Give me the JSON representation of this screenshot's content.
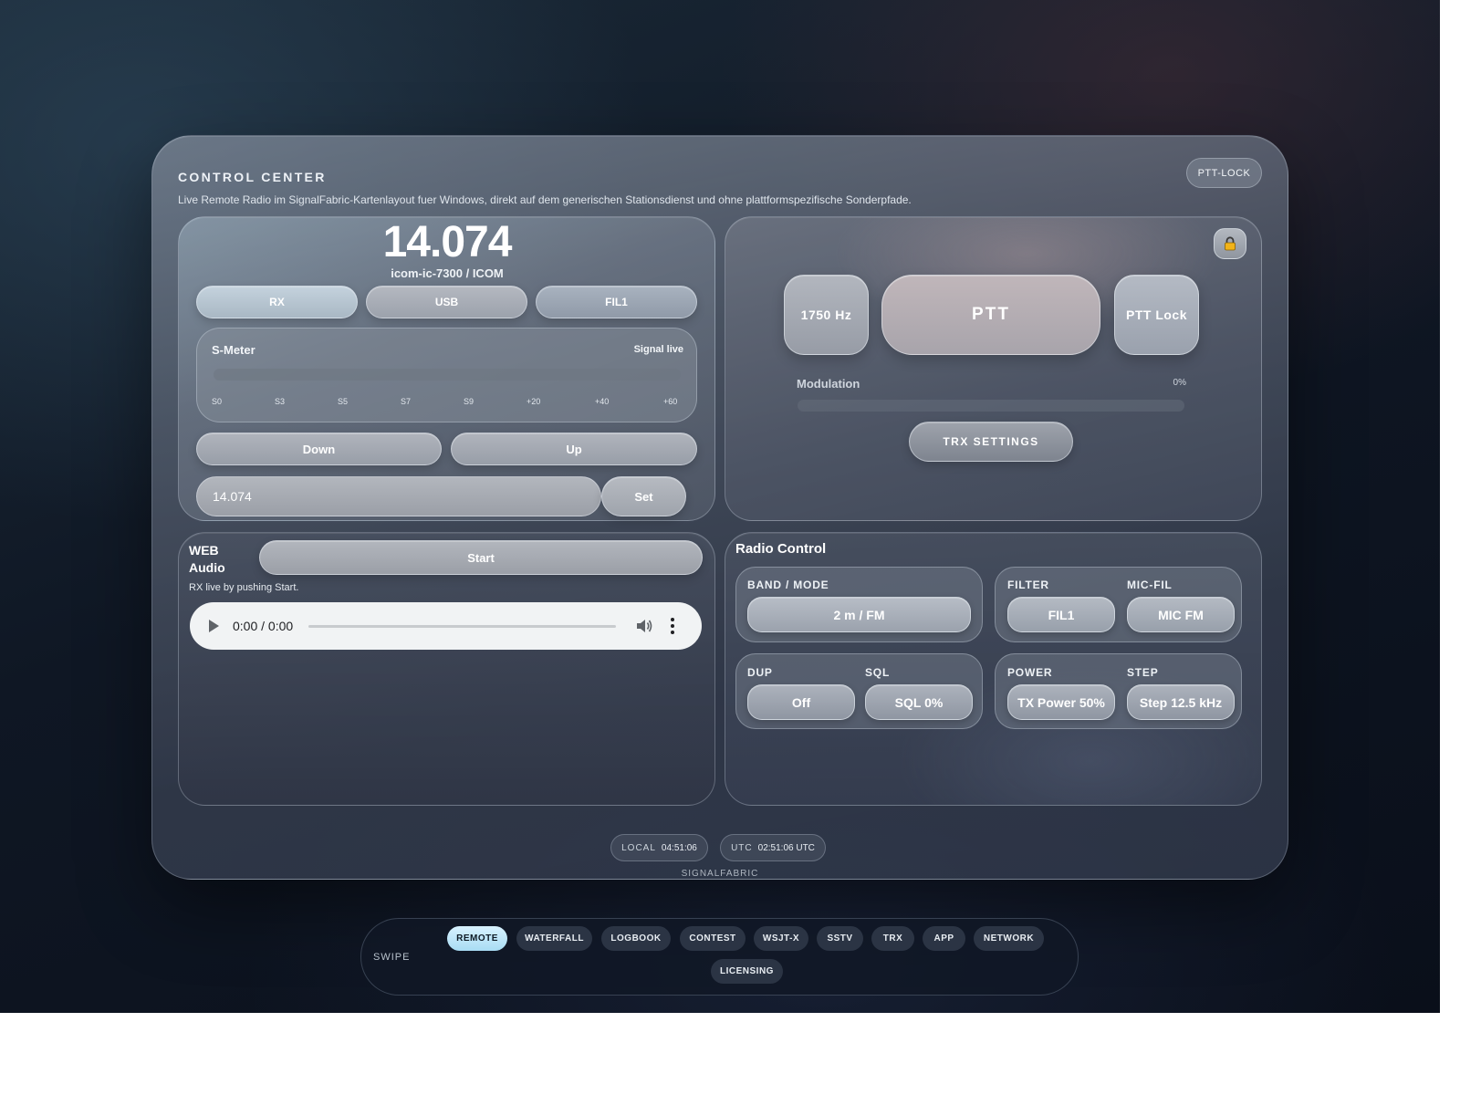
{
  "header": {
    "title": "CONTROL CENTER",
    "subtitle": "Live Remote Radio im SignalFabric-Kartenlayout fuer Windows, direkt auf dem generischen Stationsdienst und ohne plattformspezifische Sonderpfade.",
    "ptt_lock_label": "PTT-LOCK"
  },
  "frequency_panel": {
    "frequency": "14.074",
    "device": "icom-ic-7300 / ICOM",
    "rx_label": "RX",
    "mode_label": "USB",
    "filter_label": "FIL1",
    "smeter": {
      "label": "S-Meter",
      "status": "Signal live",
      "level": 0,
      "ticks": [
        "S0",
        "S3",
        "S5",
        "S7",
        "S9",
        "+20",
        "+40",
        "+60"
      ]
    },
    "down_label": "Down",
    "up_label": "Up",
    "input_value": "14.074",
    "set_label": "Set"
  },
  "ptt_panel": {
    "lock_icon": "lock-icon",
    "tone_label": "1750 Hz",
    "ptt_label": "PTT",
    "ptt_lock_label": "PTT Lock",
    "modulation_label": "Modulation",
    "modulation_value": "0%",
    "modulation_level": 0,
    "trx_settings_label": "TRX SETTINGS"
  },
  "audio_panel": {
    "title": "WEB Audio",
    "start_label": "Start",
    "note": "RX live by pushing Start.",
    "player_time": "0:00 / 0:00"
  },
  "radio_control": {
    "title": "Radio Control",
    "band_mode_label": "BAND / MODE",
    "band_mode_value": "2 m / FM",
    "filter_label": "FILTER",
    "filter_value": "FIL1",
    "mic_fil_label": "MIC-FIL",
    "mic_fil_value": "MIC FM",
    "dup_label": "DUP",
    "dup_value": "Off",
    "sql_label": "SQL",
    "sql_value": "SQL 0%",
    "power_label": "POWER",
    "power_value": "TX Power 50%",
    "step_label": "STEP",
    "step_value": "Step 12.5 kHz"
  },
  "footer": {
    "local_label": "LOCAL",
    "local_time": "04:51:06",
    "utc_label": "UTC",
    "utc_time": "02:51:06 UTC",
    "brand": "SIGNALFABRIC"
  },
  "nav": {
    "swipe_label": "SWIPE",
    "tabs": [
      "REMOTE",
      "WATERFALL",
      "LOGBOOK",
      "CONTEST",
      "WSJT-X",
      "SSTV",
      "TRX",
      "APP",
      "NETWORK",
      "LICENSING"
    ],
    "active_tab": "REMOTE"
  },
  "colors": {
    "active_tab": "#bfe8f8",
    "background": "#0f1724"
  }
}
